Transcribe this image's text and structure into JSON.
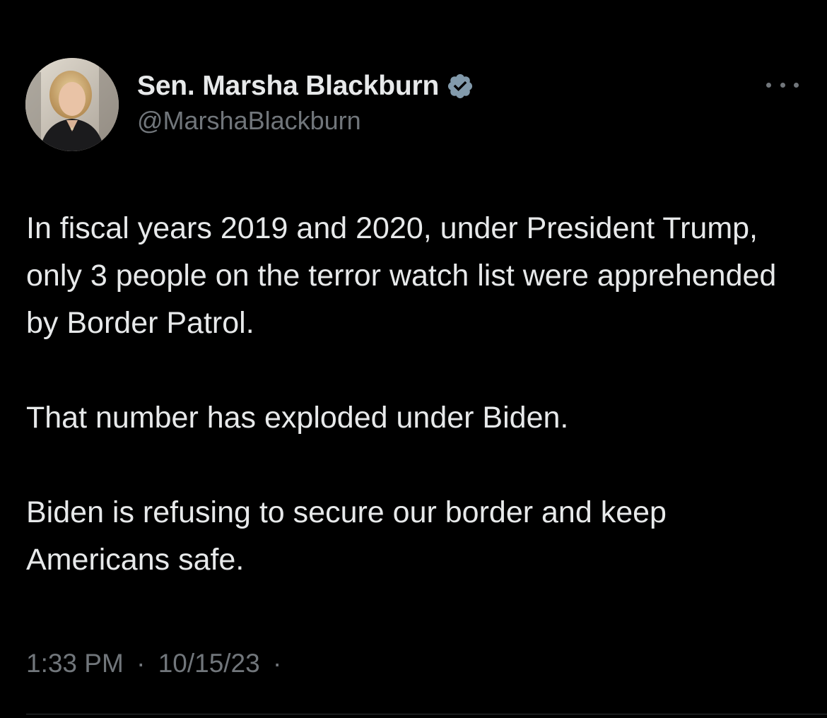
{
  "author": {
    "display_name": "Sen. Marsha Blackburn",
    "handle": "@MarshaBlackburn",
    "verified": true,
    "verified_icon": "verified-badge-icon",
    "avatar_icon": "profile-photo"
  },
  "menu": {
    "icon": "more-options-icon"
  },
  "tweet": {
    "paragraphs": [
      "In fiscal years 2019 and 2020, under President Trump, only 3 people on the terror watch list were apprehended by Border Patrol.",
      "That number has exploded under Biden.",
      "Biden is refusing to secure our border and keep Americans safe."
    ]
  },
  "meta": {
    "time": "1:33 PM",
    "separator": "·",
    "date": "10/15/23",
    "trailing_separator": "·"
  },
  "colors": {
    "background": "#000000",
    "text": "#e7e9ea",
    "muted": "#71767b",
    "divider": "#2f3336",
    "verified": "#829aab"
  }
}
